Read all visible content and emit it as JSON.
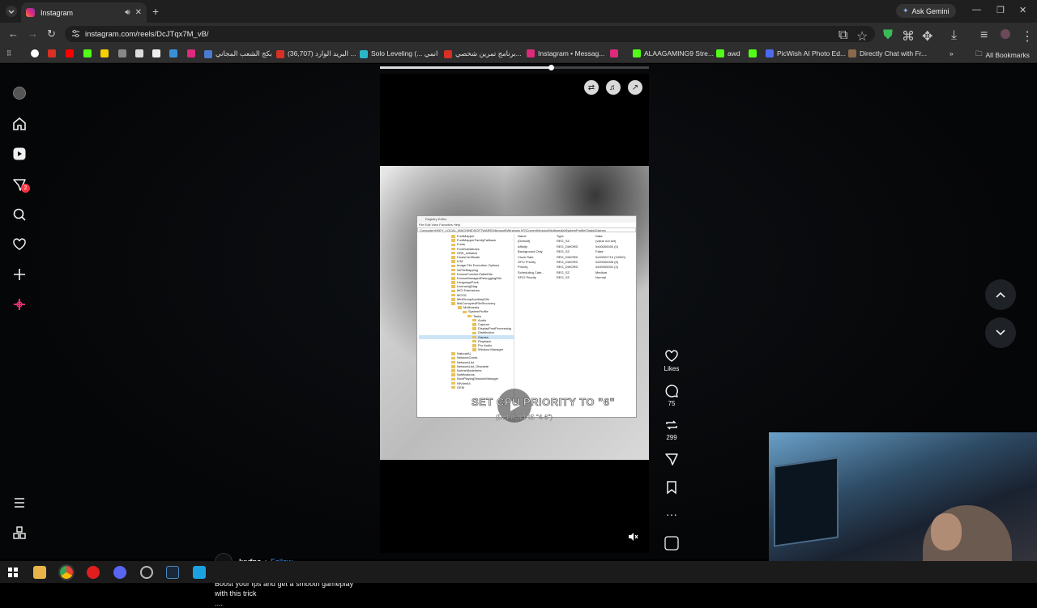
{
  "browser": {
    "tab": {
      "title": "Instagram"
    },
    "ask_gemini": "Ask Gemini",
    "url": "instagram.com/reels/DcJTqx7M_vB/",
    "bookmarks": [
      {
        "label": "بكج الشعب المجاني",
        "color": "#4a7bd0"
      },
      {
        "label": "البريد الوارد (36,707) ...",
        "color": "#d93025"
      },
      {
        "label": "Solo Leveling (... انمي",
        "color": "#2bb5c8"
      },
      {
        "label": "برنامج تمرين شخصي...",
        "color": "#d93025"
      },
      {
        "label": "Instagram • Messag...",
        "color": "#dd2a7b"
      },
      {
        "label": "ALAAGAMING9 Stre...",
        "color": "#53fc18"
      },
      {
        "label": "awd",
        "color": "#53fc18"
      },
      {
        "label": "PicWish AI Photo Ed...",
        "color": "#4a6bf0"
      },
      {
        "label": "Directly Chat with Fr...",
        "color": "#8a6a4a"
      }
    ],
    "all_bookmarks": "All Bookmarks"
  },
  "sidebar": {
    "notification_count": "2",
    "items": [
      "home-icon",
      "reels-icon",
      "messages-icon",
      "search-icon",
      "heart-icon",
      "create-icon",
      "meta-ai-icon"
    ]
  },
  "reel": {
    "progress": 0.635,
    "overlay_text": "SET CPU PRIORITY TO \"6\"",
    "overlay_sub": "(DEFAULT IS \"4-6\")",
    "registry": {
      "title": "Registry Editor",
      "menu": "File   Edit   View   Favorites   Help",
      "path": "Computer\\HKEY_LOCAL_MACHINE\\SOFTWARE\\Microsoft\\Windows NT\\CurrentVersion\\Multimedia\\SystemProfile\\Tasks\\Games",
      "tree": [
        "FontMapper",
        "FontMapperFamilyFallback",
        "Fonts",
        "FontSubstitutes",
        "GRE_Initialize",
        "HostsCertificate",
        "ICM",
        "Image File Execution Options",
        "IniFileMapping",
        "KnownFunctionTableDlls",
        "KnownManagedDebuggingDlls",
        "LanguagePack",
        "LicensingDiag",
        "MCI Extensions",
        "MCI32",
        "MiniDumpAuxiliaryDlls",
        "MsiCorruptedFileRecovery",
        "Multimedia",
        "SystemProfile",
        "Tasks",
        "Audio",
        "Capture",
        "DisplayPostProcessing",
        "Distribution",
        "Games",
        "Playback",
        "Pro Audio",
        "Window Manager",
        "NaturalAL",
        "NetworkCards",
        "NetworkList",
        "NetworkList_Obsolete",
        "NoImeModeImes",
        "Notifications",
        "NowPlayingSessionManager",
        "NtVdm64",
        "OEM"
      ],
      "columns": [
        "Name",
        "Type",
        "Data"
      ],
      "values": [
        [
          "(Default)",
          "REG_SZ",
          "(value not set)"
        ],
        [
          "Affinity",
          "REG_DWORD",
          "0x00000000 (0)"
        ],
        [
          "Background Only",
          "REG_SZ",
          "False"
        ],
        [
          "Clock Rate",
          "REG_DWORD",
          "0x00002710 (10000)"
        ],
        [
          "GPU Priority",
          "REG_DWORD",
          "0x00000008 (8)"
        ],
        [
          "Priority",
          "REG_DWORD",
          "0x00000002 (2)"
        ],
        [
          "Scheduling Cate...",
          "REG_SZ",
          "Medium"
        ],
        [
          "SFIO Priority",
          "REG_SZ",
          "Normal"
        ]
      ]
    }
  },
  "actions": {
    "likes_label": "Likes",
    "comments_count": "75",
    "reposts_count": "299"
  },
  "post": {
    "username": "lxyfps",
    "separator": "•",
    "follow": "Follow",
    "caption_line1": "Boost your fps and get a smooth gameplay",
    "caption_line2": "with this trick",
    "caption_more": "...."
  }
}
